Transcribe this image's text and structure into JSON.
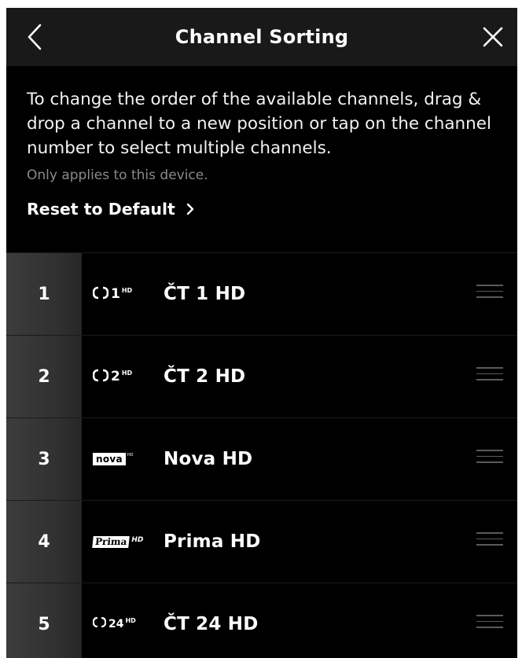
{
  "header": {
    "title": "Channel Sorting",
    "back_icon": "chevron-left-icon",
    "close_icon": "close-icon"
  },
  "intro": {
    "description": "To change the order of the available channels, drag & drop a channel to a new position or tap on the channel number to select multiple channels.",
    "note": "Only applies to this device.",
    "reset_label": "Reset to Default"
  },
  "channels": [
    {
      "number": "1",
      "name": "ČT 1 HD",
      "logo": {
        "kind": "ct",
        "text": "1",
        "hd": "HD"
      }
    },
    {
      "number": "2",
      "name": "ČT 2 HD",
      "logo": {
        "kind": "ct",
        "text": "2",
        "hd": "HD"
      }
    },
    {
      "number": "3",
      "name": "Nova HD",
      "logo": {
        "kind": "nova",
        "text": "nova",
        "hd": "HD"
      }
    },
    {
      "number": "4",
      "name": "Prima HD",
      "logo": {
        "kind": "prima",
        "text": "Prima",
        "hd": "HD"
      }
    },
    {
      "number": "5",
      "name": "ČT 24 HD",
      "logo": {
        "kind": "ct",
        "text": "24",
        "hd": "HD"
      }
    }
  ],
  "colors": {
    "background": "#000000",
    "header_bg": "#191919",
    "number_cell_bg": "#333333",
    "text_primary": "#ffffff",
    "text_muted": "#8a8a8a",
    "drag_handle": "#5a5a5a"
  }
}
